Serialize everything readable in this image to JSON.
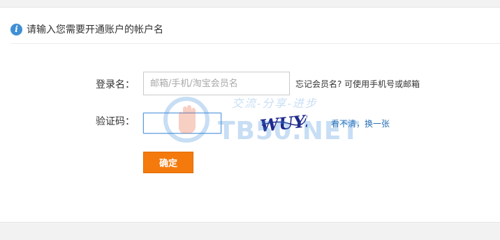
{
  "header": {
    "info_icon_glyph": "i",
    "title": "请输入您需要开通账户的帐户名"
  },
  "form": {
    "username_label": "登录名：",
    "username_placeholder": "邮箱/手机/淘宝会员名",
    "username_value": "",
    "forgot_hint": "忘记会员名? 可使用手机号或邮箱",
    "captcha_label": "验证码：",
    "captcha_value": "",
    "captcha_text": "WUY2",
    "captcha_refresh": "看不清，换一张",
    "confirm_label": "确定"
  },
  "watermark": {
    "text": "TB50.NET",
    "slogan": "交流-分享-进步"
  },
  "colors": {
    "accent_orange": "#f47a0e",
    "link_blue": "#2a6fb3",
    "info_blue": "#3f8fd5",
    "focus_border": "#5a9be0"
  }
}
